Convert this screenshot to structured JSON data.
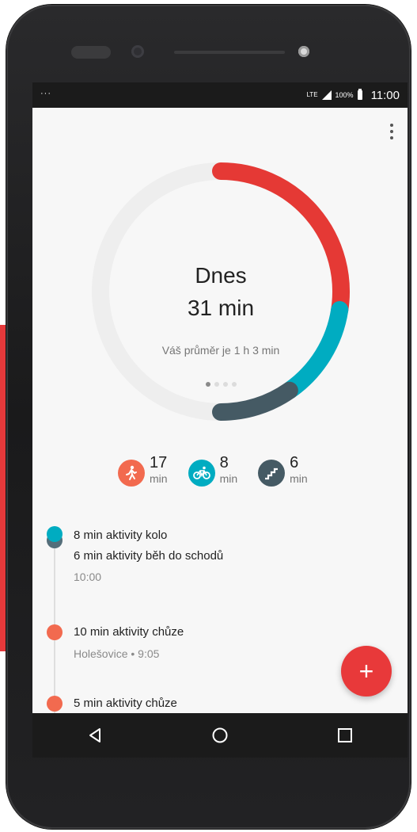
{
  "status_bar": {
    "notification": "···",
    "network": "LTE",
    "battery": "100%",
    "time": "11:00"
  },
  "summary_ring": {
    "title": "Dnes",
    "total": "31 min",
    "average": "Váš průměr je 1 h 3 min",
    "pages": 4,
    "active_page": 1,
    "segments": [
      {
        "activity": "walking",
        "minutes": 17,
        "color": "#e53935"
      },
      {
        "activity": "cycling",
        "minutes": 8,
        "color": "#00acc1"
      },
      {
        "activity": "stairs",
        "minutes": 6,
        "color": "#455a64"
      }
    ],
    "track_color": "#eeeeee"
  },
  "activity_summary": [
    {
      "icon": "walking-icon",
      "value": "17",
      "unit": "min",
      "color": "#f26a4f"
    },
    {
      "icon": "cycling-icon",
      "value": "8",
      "unit": "min",
      "color": "#00acc1"
    },
    {
      "icon": "stairs-icon",
      "value": "6",
      "unit": "min",
      "color": "#455a64"
    }
  ],
  "timeline": [
    {
      "lines": [
        "8 min aktivity kolo",
        "6 min aktivity běh do schodů"
      ],
      "subtitle": "10:00",
      "colors": [
        "#00acc1",
        "#546e7a"
      ]
    },
    {
      "lines": [
        "10 min aktivity chůze"
      ],
      "subtitle": "Holešovice • 9:05",
      "colors": [
        "#f26a4f"
      ]
    },
    {
      "lines": [
        "5 min aktivity chůze"
      ],
      "subtitle": "",
      "colors": [
        "#f26a4f"
      ]
    }
  ],
  "fab": {
    "label": "+",
    "color": "#e8393a"
  },
  "navigation": {
    "back": "back-icon",
    "home": "home-icon",
    "recents": "recents-icon"
  }
}
